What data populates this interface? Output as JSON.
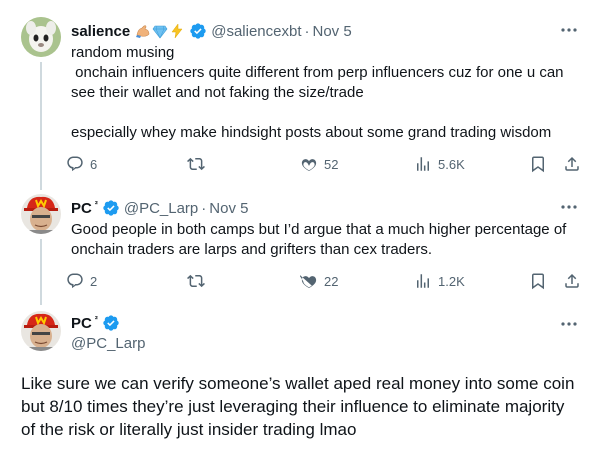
{
  "tweets": [
    {
      "name": "salience",
      "emojis": [
        "flexed-biceps-emoji",
        "gem-emoji",
        "lightning-emoji"
      ],
      "handle": "@saliencexbt",
      "dot": "·",
      "date": "Nov 5",
      "text": "random musing\n onchain influencers quite different from perp influencers cuz for one u can see their wallet and not faking the size/trade\n\nespecially whey make hindsight posts about some grand trading wisdom",
      "replies": "6",
      "retweets": "",
      "likes": "52",
      "views": "5.6K"
    },
    {
      "name": "PC",
      "name_sup": "²",
      "handle": "@PC_Larp",
      "dot": "·",
      "date": "Nov 5",
      "text": "Good people in both camps but I’d argue that a much higher percentage of onchain traders are larps and grifters than cex traders.",
      "replies": "2",
      "retweets": "",
      "likes": "22",
      "views": "1.2K"
    }
  ],
  "main_tweet": {
    "name": "PC",
    "name_sup": "²",
    "handle": "@PC_Larp",
    "text": "Like sure we can verify someone’s wallet aped real money into some coin but 8/10 times they’re just leveraging their influence to eliminate majority of the risk or literally just insider trading lmao"
  },
  "colors": {
    "verified_badge": "#1d9bf0",
    "secondary_text": "#536471",
    "thread_line": "#cfd9de"
  }
}
